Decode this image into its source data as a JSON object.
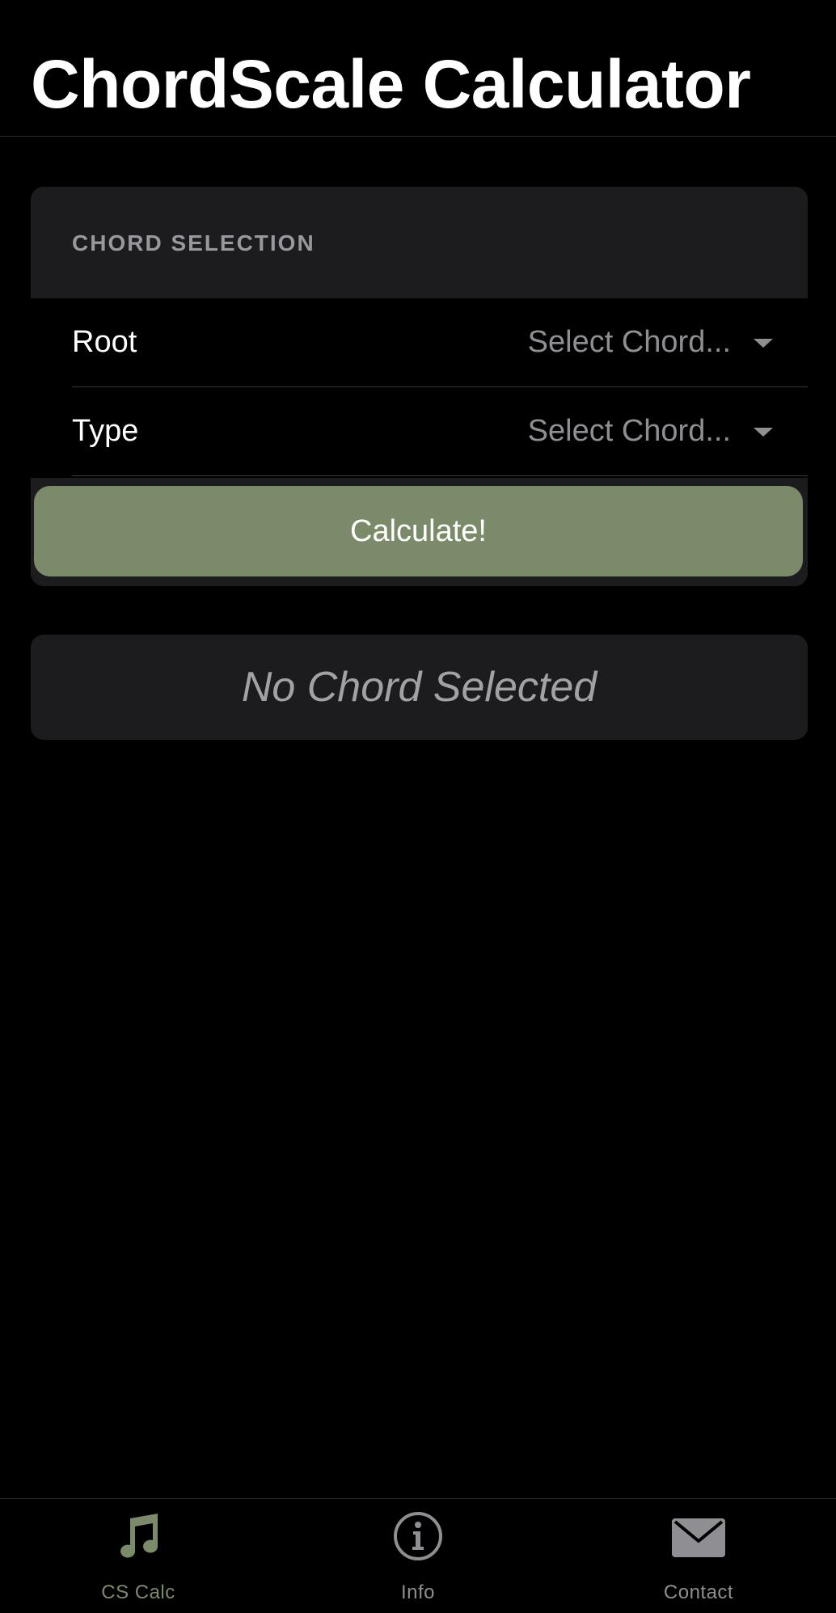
{
  "header": {
    "title": "ChordScale Calculator"
  },
  "chord_selection": {
    "section_label": "CHORD SELECTION",
    "rows": [
      {
        "label": "Root",
        "value": "Select Chord..."
      },
      {
        "label": "Type",
        "value": "Select Chord..."
      }
    ],
    "calculate_label": "Calculate!"
  },
  "result": {
    "text": "No Chord Selected"
  },
  "tab_bar": {
    "tabs": [
      {
        "label": "CS Calc",
        "icon": "music-note-icon",
        "selected": true
      },
      {
        "label": "Info",
        "icon": "info-circle-icon",
        "selected": false
      },
      {
        "label": "Contact",
        "icon": "envelope-icon",
        "selected": false
      }
    ]
  },
  "colors": {
    "accent": "#7b8b6a",
    "button_bg": "#7b8b6a",
    "inactive_tab": "#8e8e93"
  }
}
